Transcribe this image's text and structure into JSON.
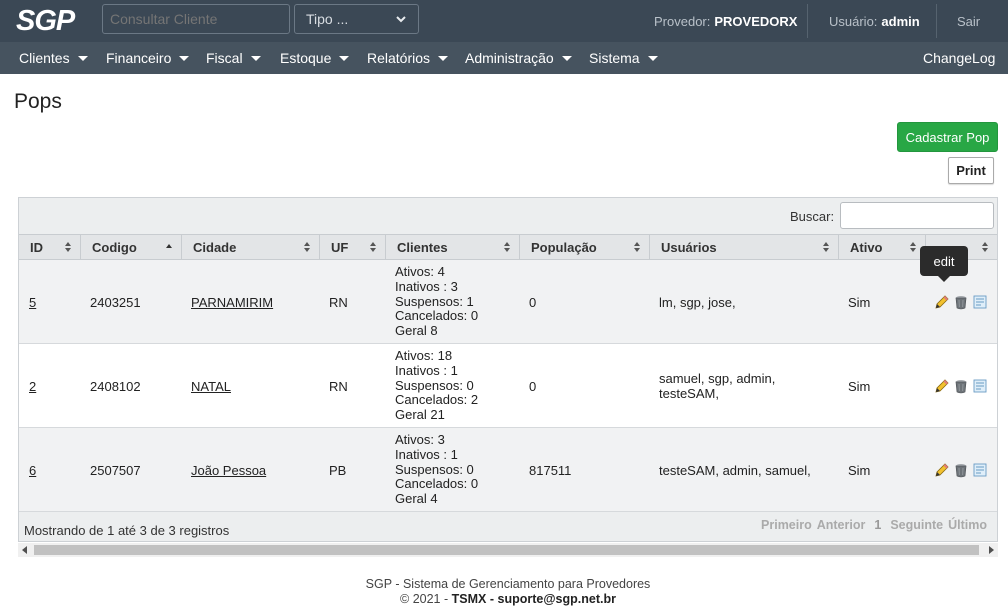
{
  "topbar": {
    "logo_text": "SGP",
    "consult_placeholder": "Consultar Cliente",
    "tipo_label": "Tipo ...",
    "provedor_label": "Provedor:",
    "provedor_value": "PROVEDORX",
    "usuario_label": "Usuário:",
    "usuario_value": "admin",
    "sair_label": "Sair"
  },
  "menu": {
    "items": [
      "Clientes",
      "Financeiro",
      "Fiscal",
      "Estoque",
      "Relatórios",
      "Administração",
      "Sistema"
    ],
    "changelog": "ChangeLog"
  },
  "page": {
    "title": "Pops",
    "cadastrar_label": "Cadastrar Pop",
    "print_label": "Print"
  },
  "table": {
    "search_label": "Buscar:",
    "columns": [
      "ID",
      "Codigo",
      "Cidade",
      "UF",
      "Clientes",
      "População",
      "Usuários",
      "Ativo",
      ""
    ],
    "rows": [
      {
        "id": "5",
        "codigo": "2403251",
        "cidade": "PARNAMIRIM",
        "uf": "RN",
        "clientes": [
          "Ativos: 4",
          "Inativos : 3",
          "Suspensos: 1",
          "Cancelados: 0",
          "Geral 8"
        ],
        "populacao": "0",
        "usuarios": "lm, sgp, jose,",
        "ativo": "Sim"
      },
      {
        "id": "2",
        "codigo": "2408102",
        "cidade": "NATAL",
        "uf": "RN",
        "clientes": [
          "Ativos: 18",
          "Inativos : 1",
          "Suspensos: 0",
          "Cancelados: 2",
          "Geral 21"
        ],
        "populacao": "0",
        "usuarios": "samuel, sgp, admin, testeSAM,",
        "ativo": "Sim"
      },
      {
        "id": "6",
        "codigo": "2507507",
        "cidade": "João Pessoa",
        "uf": "PB",
        "clientes": [
          "Ativos: 3",
          "Inativos : 1",
          "Suspensos: 0",
          "Cancelados: 0",
          "Geral 4"
        ],
        "populacao": "817511",
        "usuarios": "testeSAM, admin, samuel,",
        "ativo": "Sim"
      }
    ],
    "tooltip": "edit",
    "info": "Mostrando de 1 até 3 de 3 registros",
    "pager": {
      "first": "Primeiro",
      "previous": "Anterior",
      "current": "1",
      "next": "Seguinte",
      "last": "Último"
    }
  },
  "footer": {
    "line1": "SGP - Sistema de Gerenciamento para Provedores",
    "copyright": "© 2021 -",
    "company": "TSMX",
    "dash": "-",
    "email": "suporte@sgp.net.br"
  },
  "colors": {
    "topbar": "#3b4855",
    "menubar": "#46535f",
    "primary_button": "#28a745"
  }
}
